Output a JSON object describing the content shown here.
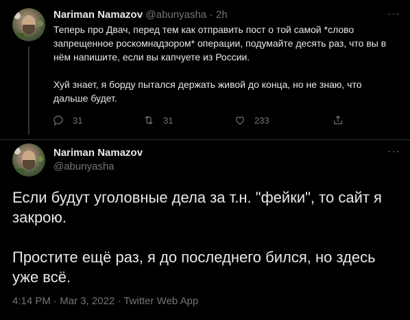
{
  "tweet1": {
    "name": "Nariman Namazov",
    "handle": "@abunyasha",
    "separator": "·",
    "time": "2h",
    "more": "···",
    "paragraph1": "Теперь про Двач, перед тем как отправить пост о той самой *слово запрещенное роскомнадзором* операции, подумайте десять раз, что вы в нём напишите, если вы капчуете из России.",
    "paragraph2": "Хуй знает, я борду пытался держать живой до конца, но не знаю, что дальше будет.",
    "replies": "31",
    "retweets": "31",
    "likes": "233"
  },
  "tweet2": {
    "name": "Nariman Namazov",
    "handle": "@abunyasha",
    "more": "···",
    "paragraph1": "Если будут уголовные дела за т.н. \"фейки\", то сайт я закрою.",
    "paragraph2": "Простите ещё раз, я до последнего бился, но здесь уже всё.",
    "time": "4:14 PM",
    "date": "Mar 3, 2022",
    "source": "Twitter Web App",
    "separator": "·"
  },
  "icons": [
    "reply-icon",
    "retweet-icon",
    "like-icon",
    "share-icon",
    "more-icon"
  ],
  "colors": {
    "background": "#000000",
    "text": "#e7e9ea",
    "muted": "#71767b",
    "divider": "#2f3336"
  }
}
